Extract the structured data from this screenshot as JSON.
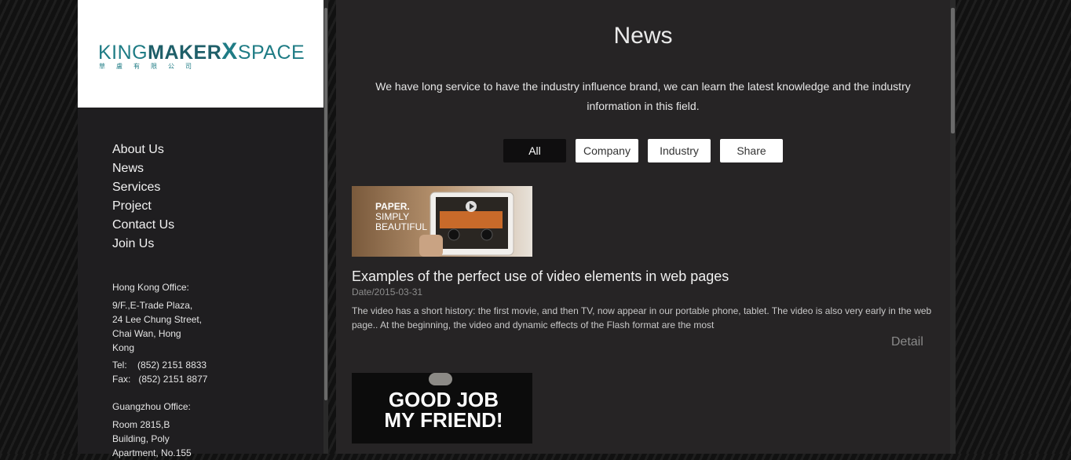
{
  "brand": {
    "logo_part1": "KING",
    "logo_part2": "MAKER",
    "logo_x": "X",
    "logo_part3": "SPACE",
    "logo_sub": "草盧有限公司"
  },
  "nav": {
    "items": [
      "About Us",
      "News",
      "Services",
      "Project",
      "Contact Us",
      "Join Us"
    ]
  },
  "offices": {
    "hk": {
      "title": "Hong Kong Office:",
      "address": [
        "9/F.,E-Trade Plaza,",
        "24 Lee Chung Street,",
        "Chai Wan, Hong",
        "Kong"
      ],
      "tel_label": "Tel:",
      "tel": "(852) 2151 8833",
      "fax_label": "Fax:",
      "fax": "(852) 2151 8877"
    },
    "gz": {
      "title": "Guangzhou Office:",
      "address": [
        "Room 2815,B",
        "Building, Poly",
        "Apartment, No.155"
      ]
    }
  },
  "page": {
    "title": "News",
    "intro": "We have long service to have the industry influence brand, we can learn the latest knowledge and the industry information in this field."
  },
  "filters": {
    "items": [
      "All",
      "Company",
      "Industry",
      "Share"
    ],
    "active": "All"
  },
  "articles": [
    {
      "image_text": [
        "PAPER.",
        "SIMPLY",
        "BEAUTIFUL"
      ],
      "title": "Examples of the perfect use of video elements in web pages",
      "date": "Date/2015-03-31",
      "desc": "The video has a short history: the first movie, and then TV, now appear in our portable phone, tablet. The video is also very early in the web page.. At the beginning, the video and dynamic effects of the Flash format are the most",
      "detail_label": "Detail"
    },
    {
      "image_text": [
        "GOOD JOB",
        "MY FRIEND!"
      ]
    }
  ],
  "colors": {
    "brand_teal": "#1f7c85",
    "page_bg": "#262425",
    "sidebar_bg": "#1f1e20"
  }
}
